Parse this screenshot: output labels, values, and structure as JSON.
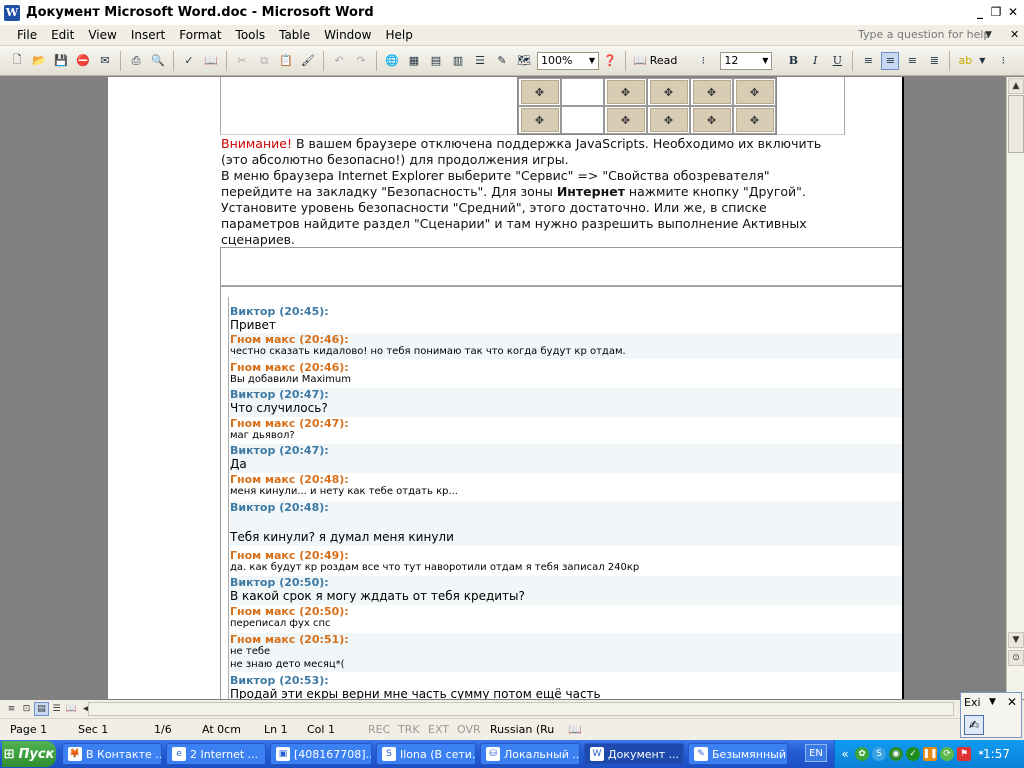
{
  "window": {
    "title": "Документ Microsoft Word.doc - Microsoft Word",
    "app_icon": "W"
  },
  "menu": {
    "items": [
      "File",
      "Edit",
      "View",
      "Insert",
      "Format",
      "Tools",
      "Table",
      "Window",
      "Help"
    ],
    "help_placeholder": "Type a question for help"
  },
  "toolbar": {
    "zoom": "100%",
    "read_label": "Read",
    "font_size": "12",
    "bold": "B",
    "italic": "I",
    "underline": "U"
  },
  "document": {
    "notice": {
      "warning": "Внимание!",
      "line1": " В вашем браузере отключена поддержка JavaScripts. Необходимо их включить (это абсолютно безопасно!) для продолжения игры.",
      "line2_pre": "В меню браузера Internet Explorer выберите \"Сервис\" => \"Свойства обозревателя\" перейдите на закладку \"Безопасность\". Для зоны ",
      "line2_bold": "Интернет",
      "line2_post": " нажмите кнопку \"Другой\". Установите уровень безопасности \"Средний\", этого достаточно. Или же, в списке параметров найдите раздел \"Сценарии\" и там нужно разрешить выполнение Активных сценариев."
    },
    "chat": [
      {
        "who": "Виктор (20:45):",
        "side": "v",
        "lines": [
          "Привет"
        ],
        "big": true
      },
      {
        "who": "Гном макс (20:46):",
        "side": "g",
        "lines": [
          "честно сказать кидалово! но тебя понимаю так что когда будут кр отдам."
        ],
        "big": false
      },
      {
        "who": "Гном макс (20:46):",
        "side": "g",
        "lines": [
          "Вы добавили Maximum"
        ],
        "big": false
      },
      {
        "who": "Виктор (20:47):",
        "side": "v",
        "lines": [
          "Что случилось?"
        ],
        "big": true
      },
      {
        "who": "Гном макс (20:47):",
        "side": "g",
        "lines": [
          "маг дьявол?"
        ],
        "big": false
      },
      {
        "who": "Виктор (20:47):",
        "side": "v",
        "lines": [
          "Да"
        ],
        "big": true
      },
      {
        "who": "Гном макс (20:48):",
        "side": "g",
        "lines": [
          "меня кинули... и нету как тебе отдать кр..."
        ],
        "big": false
      },
      {
        "who": "Виктор (20:48):",
        "side": "v",
        "lines": [
          "",
          "Тебя кинули? я думал меня кинули"
        ],
        "big": true
      },
      {
        "who": "Гном макс (20:49):",
        "side": "g",
        "lines": [
          "да. как будут кр роздам все что тут наворотили отдам я тебя записал 240кр"
        ],
        "big": false
      },
      {
        "who": "Виктор (20:50):",
        "side": "v",
        "lines": [
          "В какой срок я могу жддать от тебя кредиты?"
        ],
        "big": true
      },
      {
        "who": "Гном макс (20:50):",
        "side": "g",
        "lines": [
          "переписал фух спс"
        ],
        "big": false
      },
      {
        "who": "Гном макс (20:51):",
        "side": "g",
        "lines": [
          "не тебе",
          "не знаю дето месяц*("
        ],
        "big": false
      },
      {
        "who": "Виктор (20:53):",
        "side": "v",
        "lines": [
          "Продай эти екры верни мне часть сумму потом ещё часть"
        ],
        "big": true
      }
    ]
  },
  "status": {
    "page": "Page 1",
    "sec": "Sec 1",
    "pages": "1/6",
    "at": "At 0cm",
    "ln": "Ln 1",
    "col": "Col 1",
    "rec": "REC",
    "trk": "TRK",
    "ext": "EXT",
    "ovr": "OVR",
    "lang": "Russian (Ru"
  },
  "exi_panel": {
    "title": "Exi"
  },
  "taskbar": {
    "start": "Пуск",
    "tasks": [
      {
        "label": "В Контакте ...",
        "icon": "firefox-icon"
      },
      {
        "label": "2 Internet ...",
        "icon": "ie-icon"
      },
      {
        "label": "[408167708]...",
        "icon": "qip-icon"
      },
      {
        "label": "Ilona (В сети...",
        "icon": "skype-icon"
      },
      {
        "label": "Локальный ...",
        "icon": "disk-icon"
      },
      {
        "label": "Документ ...",
        "icon": "word-icon"
      },
      {
        "label": "Безымянный...",
        "icon": "paint-icon"
      }
    ],
    "lang": "EN",
    "clock": "1:57"
  }
}
